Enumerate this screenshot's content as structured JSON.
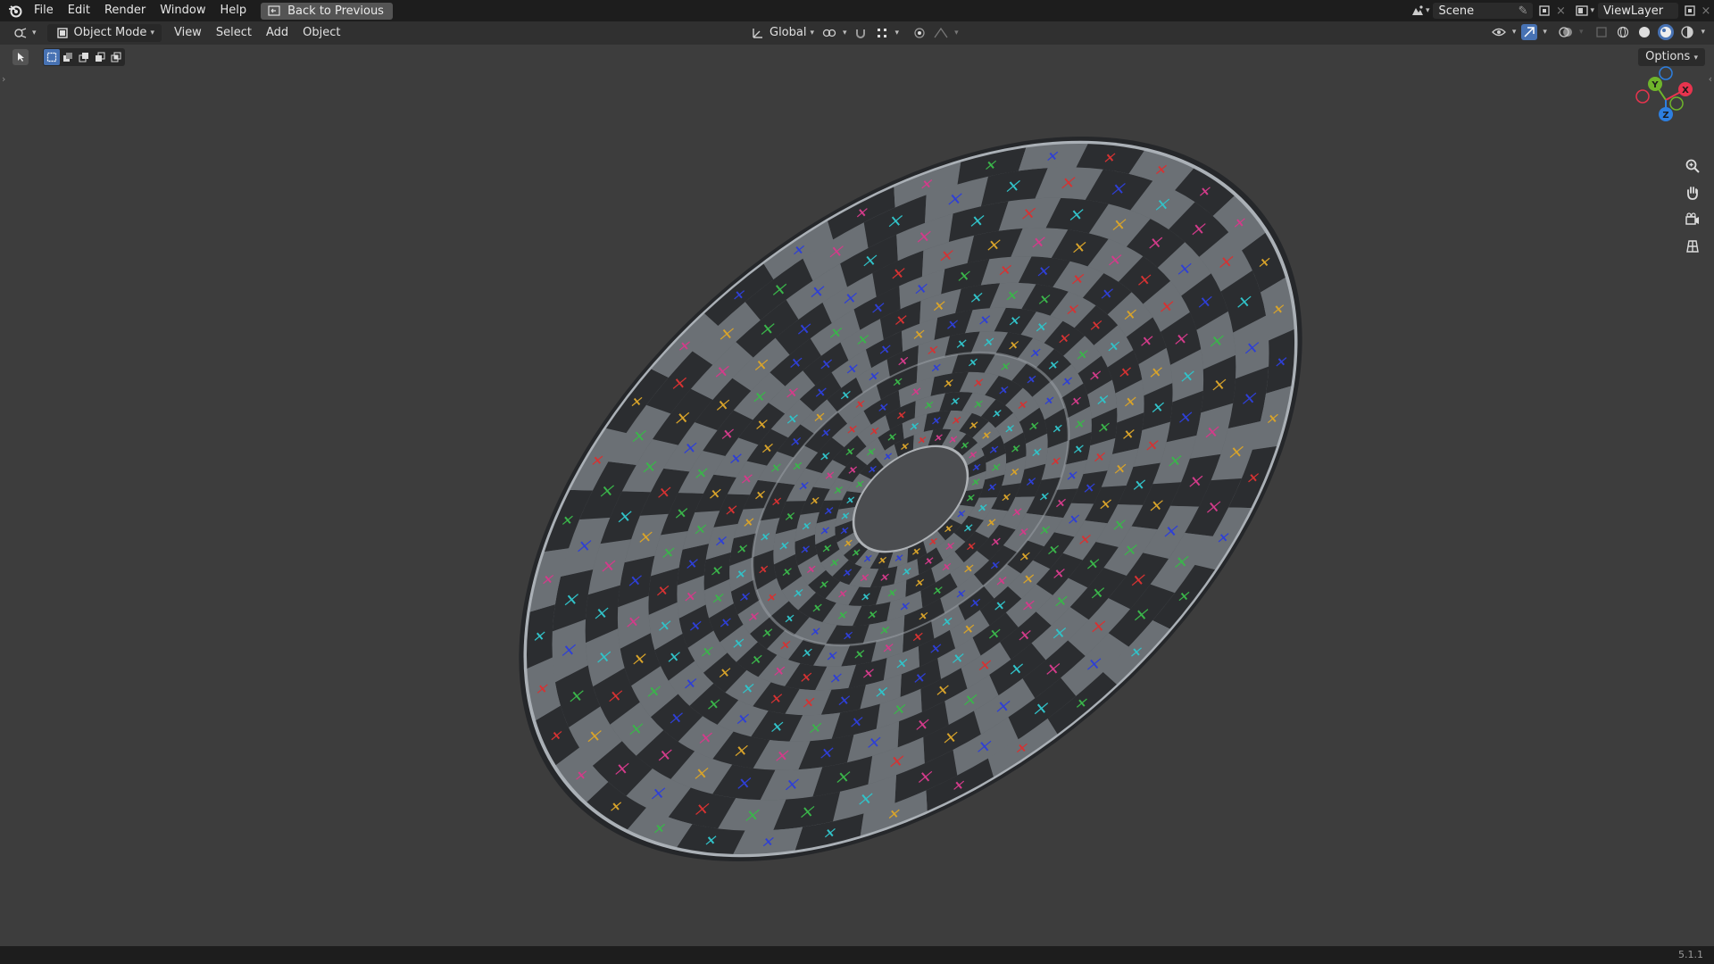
{
  "menu": {
    "items": [
      "File",
      "Edit",
      "Render",
      "Window",
      "Help"
    ],
    "back_to_previous": "Back to Previous"
  },
  "topbar_right": {
    "scene": "Scene",
    "view_layer": "ViewLayer"
  },
  "header": {
    "mode": "Object Mode",
    "menus": [
      "View",
      "Select",
      "Add",
      "Object"
    ],
    "transform_orientation": "Global",
    "options": "Options"
  },
  "gizmo": {
    "x": "X",
    "y": "Y",
    "z": "Z",
    "colors": {
      "x": "#e8344e",
      "y": "#6fb52b",
      "z": "#2d7fe0"
    }
  },
  "viewport": {
    "background": "#3d3d3d",
    "object": "checker-textured-disc",
    "checker_marker_colors": [
      "#3ab54a",
      "#31c2c8",
      "#2e3fd6",
      "#d33b8a",
      "#d63232",
      "#d8a32a"
    ]
  },
  "status": {
    "version": "5.1.1"
  },
  "icons": [
    "blender-logo-icon",
    "back-icon",
    "scene-icon",
    "pin-icon",
    "new-scene-icon",
    "close-icon",
    "view-layer-icon",
    "editor-type-icon",
    "object-mode-icon",
    "orientation-icon",
    "pivot-icon",
    "snap-icon",
    "proportional-icon",
    "visibility-icon",
    "gizmo-icon",
    "overlay-icon",
    "xray-icon",
    "wireframe-icon",
    "solid-icon",
    "material-icon",
    "rendered-icon",
    "zoom-icon",
    "pan-hand-icon",
    "camera-icon",
    "grid-icon"
  ]
}
